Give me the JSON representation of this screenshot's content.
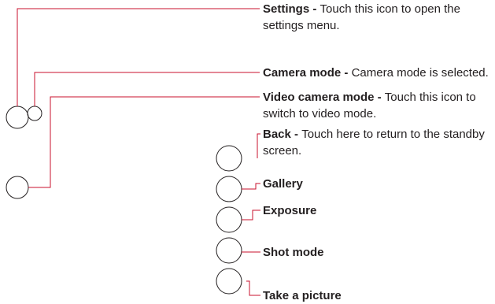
{
  "colors": {
    "line": "#c8102e",
    "circle": "#231f20",
    "text": "#231f20"
  },
  "callouts": [
    {
      "term": "Settings",
      "sep": " - ",
      "line1": "Touch this icon to open the",
      "line2": "settings menu."
    },
    {
      "term": "Camera mode",
      "sep": " - ",
      "line1": "Camera mode is selected.",
      "line2": ""
    },
    {
      "term": "Video camera mode",
      "sep": " - ",
      "line1": "Touch this icon to",
      "line2": "switch to video mode."
    },
    {
      "term": "Back",
      "sep": " - ",
      "line1": "Touch here to return to the standby",
      "line2": "screen."
    },
    {
      "term": "Gallery",
      "sep": "",
      "line1": "",
      "line2": ""
    },
    {
      "term": "Exposure",
      "sep": "",
      "line1": "",
      "line2": ""
    },
    {
      "term": "Shot mode",
      "sep": "",
      "line1": "",
      "line2": ""
    },
    {
      "term": "Take a picture",
      "sep": "",
      "line1": "",
      "line2": ""
    }
  ]
}
